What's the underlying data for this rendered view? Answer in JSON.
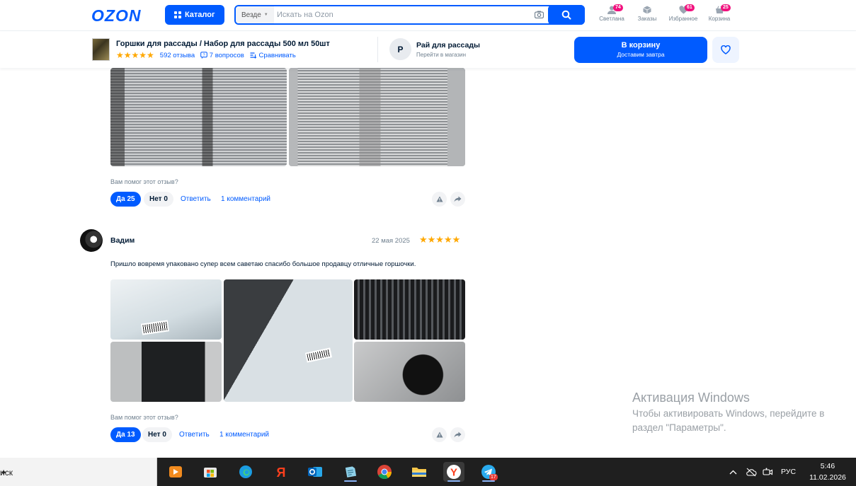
{
  "header": {
    "logo": "OZON",
    "catalog_label": "Каталог",
    "search_scope": "Везде",
    "search_placeholder": "Искать на Ozon",
    "nav": [
      {
        "label": "Светлана",
        "badge": "74"
      },
      {
        "label": "Заказы",
        "badge": ""
      },
      {
        "label": "Избранное",
        "badge": "61"
      },
      {
        "label": "Корзина",
        "badge": "25"
      }
    ]
  },
  "product_bar": {
    "title": "Горшки для рассады / Набор для рассады 500 мл 50шт",
    "rating_stars": 5,
    "reviews_link": "592 отзыва",
    "questions_link": "7 вопросов",
    "compare_link": "Сравнивать",
    "seller_initial": "Р",
    "seller_name": "Рай для рассады",
    "seller_link": "Перейти в магазин",
    "cart_label": "В корзину",
    "cart_sublabel": "Доставим завтра"
  },
  "reviews": [
    {
      "helpful_question": "Вам помог этот отзыв?",
      "yes_label": "Да 25",
      "no_label": "Нет 0",
      "reply_label": "Ответить",
      "comments_label": "1 комментарий"
    },
    {
      "author": "Вадим",
      "date": "22 мая 2025",
      "stars": 5,
      "text": "Пришло вовремя упаковано супер всем саветаю спасибо большое продавцу отличные горшочки.",
      "helpful_question": "Вам помог этот отзыв?",
      "yes_label": "Да 13",
      "no_label": "Нет 0",
      "reply_label": "Ответить",
      "comments_label": "1 комментарий"
    }
  ],
  "windows_activation": {
    "title": "Активация Windows",
    "line1": "Чтобы активировать Windows, перейдите в",
    "line2": "раздел \"Параметры\"."
  },
  "taskbar": {
    "search_text": "иск",
    "telegram_badge": "17",
    "language": "РУС",
    "time": "5:46",
    "date": "11.02.2026"
  },
  "colors": {
    "brand_blue": "#005bff",
    "badge_pink": "#f1117e",
    "star_orange": "#ffa800"
  }
}
